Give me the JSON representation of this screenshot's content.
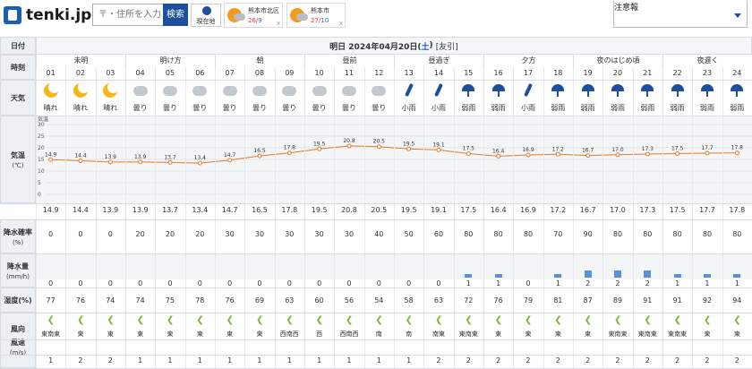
{
  "header": {
    "logo_text": "tenki.jp",
    "search_placeholder": "〒・住所を入力",
    "search_button": "検索",
    "location_button": "現在地",
    "cities": [
      {
        "name": "熊本市北区",
        "max": "26",
        "min": "9"
      },
      {
        "name": "熊本市",
        "max": "27",
        "min": "10"
      }
    ],
    "warning_label": "注意報"
  },
  "labels": {
    "date": "日付",
    "hour": "時刻",
    "weather": "天気",
    "temp": "気温",
    "temp_unit": "(℃)",
    "precip_prob": "降水確率",
    "precip_prob_unit": "(%)",
    "precip": "降水量",
    "precip_unit": "(mm/h)",
    "humidity": "湿度(%)",
    "wind_dir": "風向",
    "wind_speed": "風速",
    "wind_unit": "(m/s)"
  },
  "date_line": {
    "prefix": "明日 2024年04月20日(",
    "weekday": "土",
    "suffix": ")",
    "rokuyo": "[友引]"
  },
  "periods": [
    "未明",
    "明け方",
    "朝",
    "昼前",
    "昼過ぎ",
    "夕方",
    "夜のはじめ頃",
    "夜遅く"
  ],
  "hours": [
    "01",
    "02",
    "03",
    "04",
    "05",
    "06",
    "07",
    "08",
    "09",
    "10",
    "11",
    "12",
    "13",
    "14",
    "15",
    "16",
    "17",
    "18",
    "19",
    "20",
    "21",
    "22",
    "23",
    "24"
  ],
  "weather_text": [
    "晴れ",
    "晴れ",
    "晴れ",
    "曇り",
    "曇り",
    "曇り",
    "曇り",
    "曇り",
    "曇り",
    "曇り",
    "曇り",
    "曇り",
    "小雨",
    "小雨",
    "弱雨",
    "弱雨",
    "小雨",
    "弱雨",
    "弱雨",
    "弱雨",
    "弱雨",
    "弱雨",
    "弱雨",
    "弱雨"
  ],
  "weather_icons": [
    "moon",
    "moon",
    "moon",
    "cloud",
    "cloud",
    "cloud",
    "cloud",
    "cloud",
    "cloud",
    "cloud",
    "cloud",
    "cloud",
    "closed-umbrella",
    "closed-umbrella",
    "umbrella",
    "umbrella",
    "closed-umbrella",
    "umbrella",
    "umbrella",
    "umbrella",
    "umbrella",
    "umbrella",
    "umbrella",
    "umbrella"
  ],
  "temp_axis_ticks": [
    "30",
    "25",
    "20",
    "15",
    "10",
    "5",
    "0"
  ],
  "temp_axis_label": "気温",
  "chart_data": {
    "type": "line",
    "x": [
      "01",
      "02",
      "03",
      "04",
      "05",
      "06",
      "07",
      "08",
      "09",
      "10",
      "11",
      "12",
      "13",
      "14",
      "15",
      "16",
      "17",
      "18",
      "19",
      "20",
      "21",
      "22",
      "23",
      "24"
    ],
    "series": [
      {
        "values": [
          14.9,
          14.4,
          13.9,
          13.9,
          13.7,
          13.4,
          14.7,
          16.5,
          17.8,
          19.5,
          20.8,
          20.5,
          19.5,
          19.1,
          17.5,
          16.4,
          16.9,
          17.2,
          16.7,
          17.0,
          17.3,
          17.5,
          17.7,
          17.8
        ]
      }
    ],
    "ylim": [
      0,
      30
    ]
  },
  "temps": [
    "14.9",
    "14.4",
    "13.9",
    "13.9",
    "13.7",
    "13.4",
    "14.7",
    "16.5",
    "17.8",
    "19.5",
    "20.8",
    "20.5",
    "19.5",
    "19.1",
    "17.5",
    "16.4",
    "16.9",
    "17.2",
    "16.7",
    "17.0",
    "17.3",
    "17.5",
    "17.7",
    "17.8"
  ],
  "precip_prob": [
    "0",
    "0",
    "0",
    "20",
    "20",
    "20",
    "30",
    "30",
    "30",
    "30",
    "30",
    "40",
    "50",
    "60",
    "80",
    "80",
    "80",
    "70",
    "90",
    "80",
    "80",
    "80",
    "80",
    "80"
  ],
  "precip": [
    "0",
    "0",
    "0",
    "0",
    "0",
    "0",
    "0",
    "0",
    "0",
    "0",
    "0",
    "0",
    "0",
    "0",
    "1",
    "1",
    "0",
    "1",
    "2",
    "2",
    "2",
    "1",
    "1",
    "1"
  ],
  "humidity": [
    "77",
    "76",
    "74",
    "74",
    "75",
    "78",
    "76",
    "69",
    "63",
    "60",
    "56",
    "54",
    "58",
    "63",
    "72",
    "76",
    "79",
    "81",
    "87",
    "89",
    "91",
    "91",
    "92",
    "94"
  ],
  "wind_dir": [
    "東南東",
    "東",
    "東",
    "東",
    "東",
    "東",
    "東",
    "東",
    "西南西",
    "西",
    "西南西",
    "南",
    "南",
    "南東",
    "東南東",
    "東",
    "東",
    "東",
    "東",
    "東南東",
    "東南東",
    "東南東",
    "東",
    "東"
  ],
  "wind_speed": [
    "1",
    "2",
    "2",
    "1",
    "1",
    "1",
    "1",
    "1",
    "1",
    "1",
    "1",
    "1",
    "1",
    "2",
    "2",
    "2",
    "2",
    "2",
    "2",
    "2",
    "2",
    "2",
    "2",
    "2"
  ],
  "colors": {
    "accent": "#1d4f9c",
    "temp_line": "#e07c2a",
    "rain_bar": "#5b8fd6",
    "saturday": "#2659c6"
  }
}
